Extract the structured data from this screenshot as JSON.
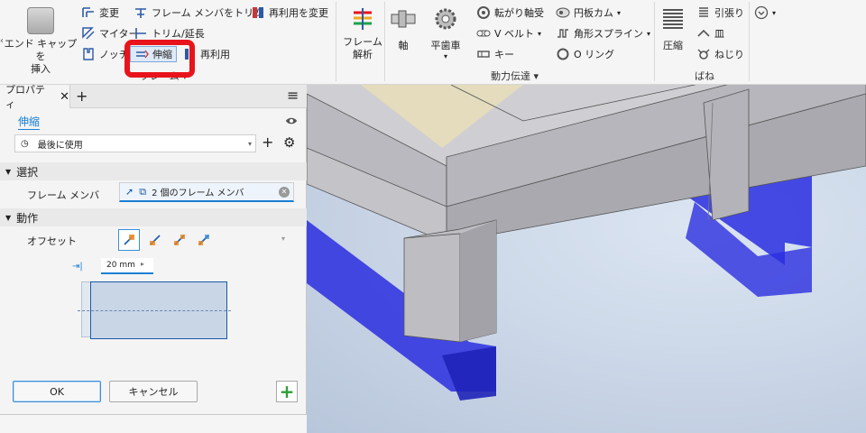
{
  "ribbon": {
    "frame": {
      "end_cap_label_l1": "エンド キャップを",
      "end_cap_label_l2": "挿入",
      "change": "変更",
      "trim_member": "フレーム メンバをトリム",
      "reuse_change": "再利用を変更",
      "miter": "マイター",
      "trim_extend": "トリム/延長",
      "notch": "ノッチ",
      "lengthen": "伸縮",
      "reuse": "再利用",
      "group_title": "フレーム"
    },
    "frame_analysis": {
      "label_l1": "フレーム",
      "label_l2": "解析"
    },
    "power_transmission": {
      "shaft": "軸",
      "spur_gear": "平歯車",
      "bearing": "転がり軸受",
      "v_belt": "V ベルト",
      "key": "キー",
      "disc_cam": "円板カム",
      "spline": "角形スプライン",
      "o_ring": "O リング",
      "group_title": "動力伝達"
    },
    "springs": {
      "compression": "圧縮",
      "tension": "引張り",
      "belleville": "皿",
      "torsion": "ねじり",
      "group_title": "ばね"
    },
    "highlight_color": "#e8141b"
  },
  "panel": {
    "tab_title": "プロパティ",
    "command_name": "伸縮",
    "preset": "最後に使用",
    "sections": {
      "select": "選択",
      "action": "動作"
    },
    "frame_member_label": "フレーム メンバ",
    "frame_member_value": "2 個のフレーム メンバ",
    "offset_label": "オフセット",
    "offset_value": "20 mm",
    "ok": "OK",
    "cancel": "キャンセル"
  },
  "colors": {
    "accent": "#1a7fd4",
    "member_blue": "#2a2ee0",
    "add_green": "#2e9e3a"
  }
}
